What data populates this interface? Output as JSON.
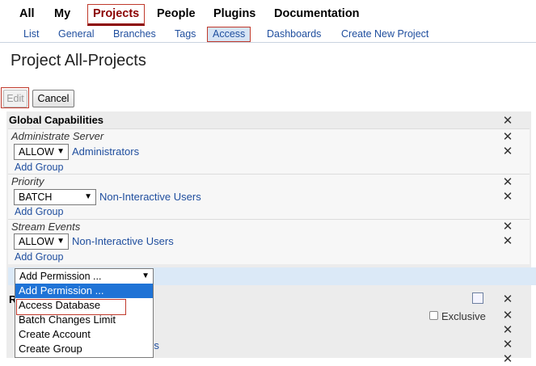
{
  "nav": {
    "items": [
      {
        "label": "All",
        "active": false
      },
      {
        "label": "My",
        "active": false
      },
      {
        "label": "Projects",
        "active": true
      },
      {
        "label": "People",
        "active": false
      },
      {
        "label": "Plugins",
        "active": false
      },
      {
        "label": "Documentation",
        "active": false
      }
    ]
  },
  "subnav": {
    "items": [
      {
        "label": "List"
      },
      {
        "label": "General"
      },
      {
        "label": "Branches"
      },
      {
        "label": "Tags"
      },
      {
        "label": "Access",
        "active": true
      },
      {
        "label": "Dashboards"
      },
      {
        "label": "Create New Project"
      }
    ]
  },
  "page": {
    "title": "Project All-Projects"
  },
  "buttons": {
    "edit": "Edit",
    "cancel": "Cancel"
  },
  "global": {
    "title": "Global Capabilities",
    "capabilities": [
      {
        "name": "Administrate Server",
        "action": "ALLOW",
        "group": "Administrators",
        "add_group": "Add Group"
      },
      {
        "name": "Priority",
        "action": "BATCH",
        "group": "Non-Interactive Users",
        "add_group": "Add Group"
      },
      {
        "name": "Stream Events",
        "action": "ALLOW",
        "group": "Non-Interactive Users",
        "add_group": "Add Group"
      }
    ],
    "add_permission": "Add Permission ...",
    "dropdown_options": [
      "Add Permission ...",
      "Access Database",
      "Batch Changes Limit",
      "Create Account",
      "Create Group"
    ]
  },
  "lower": {
    "partial_letter": "R",
    "exclusive_label": "Exclusive",
    "partial_text": "rs"
  },
  "icons": {
    "close": "close-icon",
    "pencil": "pencil-icon"
  },
  "colors": {
    "link": "#1f4e9e",
    "active_nav": "#8b0000",
    "highlight_outline": "#c0392b",
    "dropdown_selected": "#1f73d6",
    "panel_bg": "#ececec",
    "add_permission_row": "#dbe9f7"
  }
}
